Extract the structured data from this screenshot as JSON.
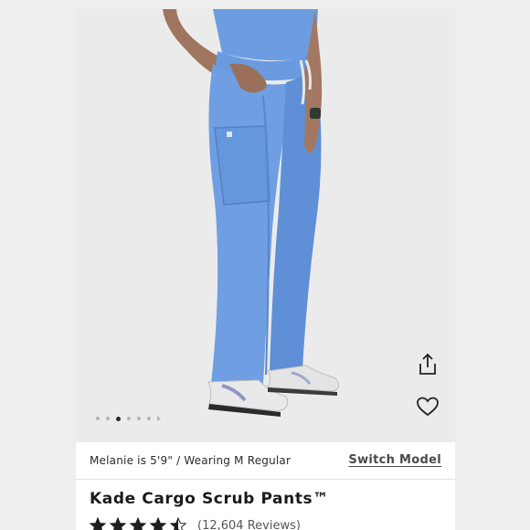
{
  "product": {
    "title": "Kade Cargo Scrub Pants™",
    "rating": 4.5,
    "rating_max": 5,
    "reviews_label": "(12,604 Reviews)"
  },
  "model": {
    "info": "Melanie is 5'9\" / Wearing M Regular",
    "switch_label": "Switch Model"
  },
  "gallery": {
    "image_count": 7,
    "active_index": 2,
    "pants_color": "#6f9fe2",
    "top_color": "#6c9de0"
  },
  "icons": {
    "share": "share-icon",
    "favorite": "heart-icon",
    "star": "star-icon"
  }
}
